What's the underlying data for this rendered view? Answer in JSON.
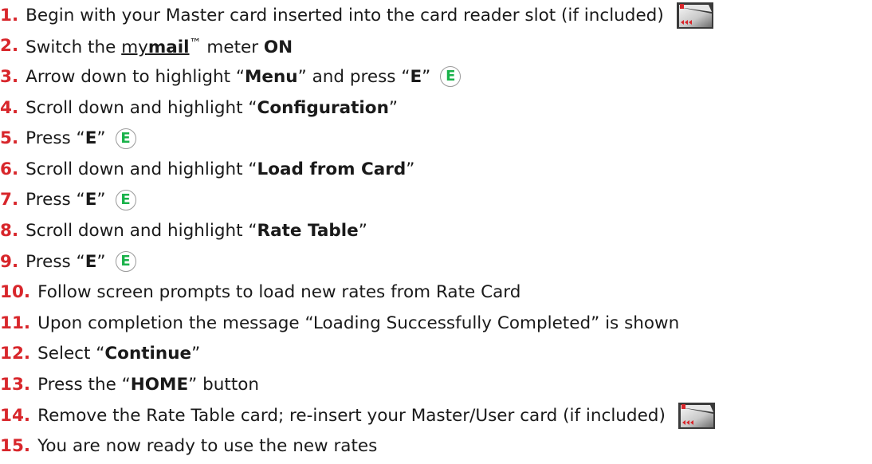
{
  "steps": [
    {
      "num": "1.",
      "segments": [
        {
          "text": "Begin with your Master card inserted into the card reader slot (if included)"
        }
      ],
      "icon": "card-icon"
    },
    {
      "num": "2.",
      "segments": [
        {
          "text": "Switch the "
        },
        {
          "text": "my",
          "underline": true
        },
        {
          "text": "mail",
          "bold": true,
          "underline": true
        },
        {
          "text": "™",
          "sup": true
        },
        {
          "text": " meter "
        },
        {
          "text": "ON",
          "bold": true
        }
      ]
    },
    {
      "num": "3.",
      "segments": [
        {
          "text": "Arrow down to highlight “"
        },
        {
          "text": "Menu",
          "bold": true
        },
        {
          "text": "” and press “"
        },
        {
          "text": "E",
          "bold": true
        },
        {
          "text": "”"
        }
      ],
      "icon": "e-button"
    },
    {
      "num": "4.",
      "segments": [
        {
          "text": "Scroll down and highlight “"
        },
        {
          "text": "Configuration",
          "bold": true
        },
        {
          "text": "”"
        }
      ]
    },
    {
      "num": "5.",
      "segments": [
        {
          "text": "Press “"
        },
        {
          "text": "E",
          "bold": true
        },
        {
          "text": "”"
        }
      ],
      "icon": "e-button"
    },
    {
      "num": "6.",
      "segments": [
        {
          "text": "Scroll down and highlight “"
        },
        {
          "text": "Load from Card",
          "bold": true
        },
        {
          "text": "”"
        }
      ]
    },
    {
      "num": "7.",
      "segments": [
        {
          "text": "Press “"
        },
        {
          "text": "E",
          "bold": true
        },
        {
          "text": "”"
        }
      ],
      "icon": "e-button"
    },
    {
      "num": "8.",
      "segments": [
        {
          "text": "Scroll down and highlight “"
        },
        {
          "text": "Rate Table",
          "bold": true
        },
        {
          "text": "”"
        }
      ]
    },
    {
      "num": "9.",
      "segments": [
        {
          "text": "Press “"
        },
        {
          "text": "E",
          "bold": true
        },
        {
          "text": "”"
        }
      ],
      "icon": "e-button"
    },
    {
      "num": "10.",
      "segments": [
        {
          "text": "Follow screen prompts to load new rates from Rate Card"
        }
      ]
    },
    {
      "num": "11.",
      "segments": [
        {
          "text": "Upon completion the message “Loading Successfully Completed” is shown"
        }
      ]
    },
    {
      "num": "12.",
      "segments": [
        {
          "text": "Select “"
        },
        {
          "text": "Continue",
          "bold": true
        },
        {
          "text": "”"
        }
      ]
    },
    {
      "num": "13.",
      "segments": [
        {
          "text": "Press the “"
        },
        {
          "text": "HOME",
          "bold": true
        },
        {
          "text": "” button"
        }
      ]
    },
    {
      "num": "14.",
      "segments": [
        {
          "text": "Remove the Rate Table card; re-insert your Master/User card (if included)"
        }
      ],
      "icon": "card-icon"
    },
    {
      "num": "15.",
      "segments": [
        {
          "text": "You are now ready to use the new rates"
        }
      ]
    }
  ],
  "e_button_label": "E",
  "colors": {
    "step_number": "#d8262b",
    "e_letter": "#1ab24a",
    "body_text": "#1a1a1a"
  }
}
